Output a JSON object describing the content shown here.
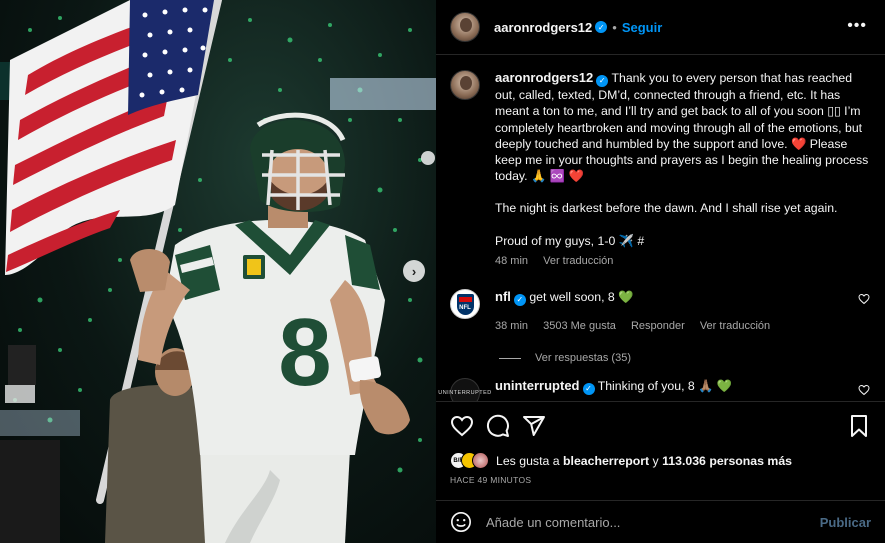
{
  "header": {
    "username": "aaronrodgers12",
    "follow_label": "Seguir",
    "more_label": "•••"
  },
  "caption": {
    "username": "aaronrodgers12",
    "paragraph_1": "Thank you to every person that has reached out, called, texted, DM’d, connected through a friend, etc. It has meant a ton to me, and I’ll try and get back to all of you soon ▯▯ I’m completely heartbroken and moving through all of the emotions, but deeply touched and humbled by the support and love. ❤️ Please keep me in your thoughts and prayers as I begin the healing process today. 🙏 ♾️ ❤️",
    "paragraph_2": "The night is darkest before the dawn. And I shall rise yet again.",
    "paragraph_3": "Proud of my guys, 1-0 ✈️ #",
    "time": "48 min",
    "see_translation": "Ver traducción"
  },
  "comments": [
    {
      "username": "nfl",
      "text": "get well soon, 8 💚",
      "time": "38 min",
      "likes": "3503 Me gusta",
      "reply": "Responder",
      "see_translation": "Ver traducción",
      "avatar_icon": "nfl-shield-logo"
    },
    {
      "username": "uninterrupted",
      "text": "Thinking of you, 8 🙏🏽 💚",
      "avatar_label": "UNINTERRUPTED",
      "avatar_icon": "uninterrupted-logo"
    }
  ],
  "view_replies": "Ver respuestas (35)",
  "likes": {
    "prefix": "Les gusta a",
    "user": "bleacherreport",
    "connector": "y",
    "count": "113.036 personas más",
    "avatar_label": "B/R"
  },
  "post_time": "HACE 49 MINUTOS",
  "add_comment": {
    "placeholder": "Añade un comentario...",
    "publish_label": "Publicar"
  },
  "photo": {
    "jersey_number": "8",
    "carousel_next": "›"
  },
  "colors": {
    "accent": "#0095f6",
    "jets_green": "#1f4e36",
    "background": "#000000"
  }
}
